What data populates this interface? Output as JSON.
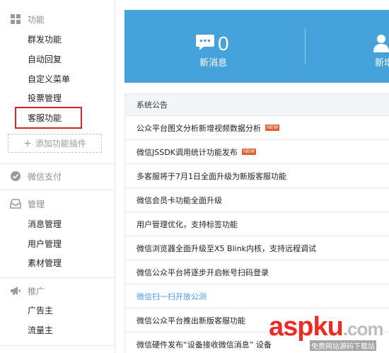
{
  "sidebar": {
    "func_head": "功能",
    "func_items": [
      "群发功能",
      "自动回复",
      "自定义菜单",
      "投票管理",
      "客服功能"
    ],
    "add_plugin": "添加功能插件",
    "pay_head": "微信支付",
    "manage_head": "管理",
    "manage_items": [
      "消息管理",
      "用户管理",
      "素材管理"
    ],
    "promo_head": "推广",
    "promo_items": [
      "广告主",
      "流量主"
    ]
  },
  "banner": {
    "new_msg_count": "0",
    "new_msg_label": "新消息",
    "new_user_label": "新增"
  },
  "announcements": {
    "header": "系统公告",
    "items": [
      {
        "text": "公众平台图文分析新增视频数据分析",
        "badge": "NEW"
      },
      {
        "text": "微信JSSDK调用统计功能发布",
        "badge": "NEW"
      },
      {
        "text": "多客服将于7月1日全面升级为新版客服功能",
        "badge": ""
      },
      {
        "text": "微信会员卡功能全面升级",
        "badge": ""
      },
      {
        "text": "用户管理优化，支持标签功能",
        "badge": ""
      },
      {
        "text": "微信浏览器全面升级至X5 Blink内核，支持远程调试",
        "badge": ""
      },
      {
        "text": "微信公众平台将逐步开启帐号扫码登录",
        "badge": ""
      },
      {
        "text": "微信扫一扫开放公测",
        "badge": ""
      },
      {
        "text": "微信公众平台推出新版客服功能",
        "badge": ""
      },
      {
        "text": "微信硬件发布“设备接收微信消息” 设备",
        "badge": ""
      }
    ]
  },
  "watermark": {
    "brand_main": "aspku",
    "brand_suffix": ".com",
    "tagline": "免费网站源码下载站"
  },
  "colors": {
    "banner": "#46a2d9",
    "highlight": "#d3262a",
    "link": "#459ae9",
    "new_badge": "#e45d2d"
  }
}
